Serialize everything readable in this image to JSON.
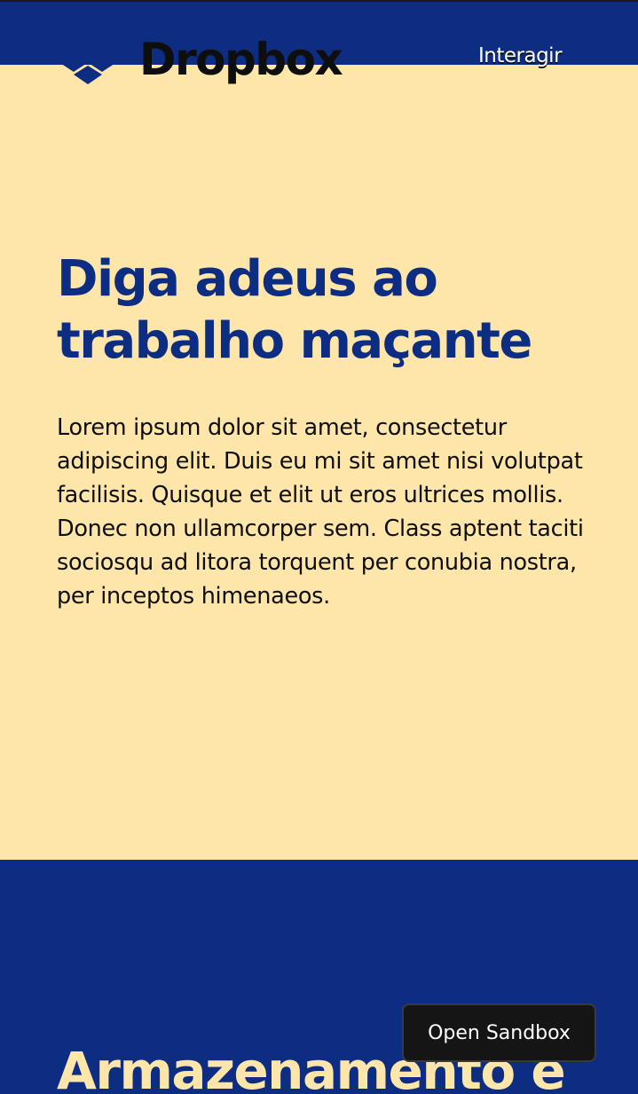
{
  "header": {
    "logo_text": "Dropbox",
    "nav_link": "Interagir"
  },
  "hero": {
    "title": "Diga adeus ao trabalho maçante",
    "text": "Lorem ipsum dolor sit amet, consectetur adipiscing elit. Duis eu mi sit amet nisi volutpat facilisis. Quisque et elit ut eros ultrices mollis. Donec non ullamcorper sem. Class aptent taciti sociosqu ad litora torquent per conubia nostra, per inceptos himenaeos."
  },
  "section": {
    "title": "Armazenamento e"
  },
  "sandbox": {
    "button_label": "Open Sandbox"
  },
  "colors": {
    "primary_blue": "#0d2d82",
    "hero_background": "#fee6aa",
    "text_dark": "#0e0e0e",
    "button_background": "#151515"
  },
  "icons": {
    "logo": "dropbox-logo-icon"
  }
}
